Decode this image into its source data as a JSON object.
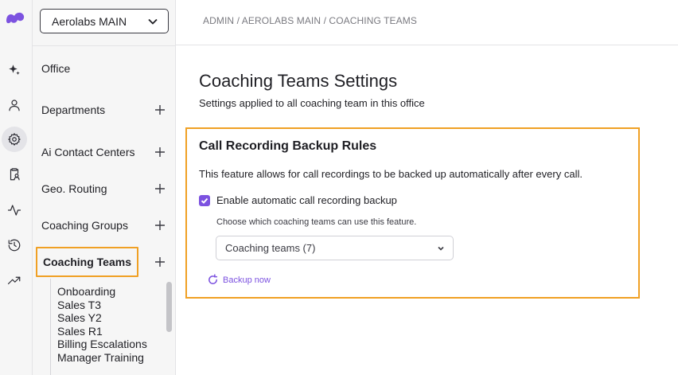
{
  "brand": {
    "accent": "#7c52e0",
    "highlight": "#f0a024"
  },
  "rail": {
    "items": [
      {
        "icon": "sparkles-icon"
      },
      {
        "icon": "user-icon"
      },
      {
        "icon": "gear-icon",
        "active": true
      },
      {
        "icon": "clipboard-user-icon"
      },
      {
        "icon": "activity-icon"
      },
      {
        "icon": "history-icon"
      },
      {
        "icon": "trending-up-icon"
      }
    ]
  },
  "sidebar": {
    "office_select": "Aerolabs MAIN",
    "items": [
      {
        "label": "Office"
      },
      {
        "label": "Departments"
      },
      {
        "label": "Ai Contact Centers"
      },
      {
        "label": "Geo. Routing"
      },
      {
        "label": "Coaching Groups"
      },
      {
        "label": "Coaching Teams"
      }
    ],
    "sub_items": [
      {
        "label": "Onboarding"
      },
      {
        "label": "Sales T3"
      },
      {
        "label": "Sales Y2"
      },
      {
        "label": "Sales R1"
      },
      {
        "label": "Billing Escalations"
      },
      {
        "label": "Manager Training"
      }
    ]
  },
  "header": {
    "breadcrumb": "ADMIN / AEROLABS MAIN / COACHING TEAMS"
  },
  "main": {
    "title": "Coaching Teams Settings",
    "subtitle": "Settings applied to all coaching team in this office",
    "card": {
      "title": "Call Recording Backup Rules",
      "description": "This feature allows for call recordings to be backed up automatically after every call.",
      "checkbox_label": "Enable automatic call recording backup",
      "checkbox_checked": true,
      "helper": "Choose which coaching teams can use this feature.",
      "teams_select": "Coaching teams (7)",
      "backup_link": "Backup now"
    }
  }
}
